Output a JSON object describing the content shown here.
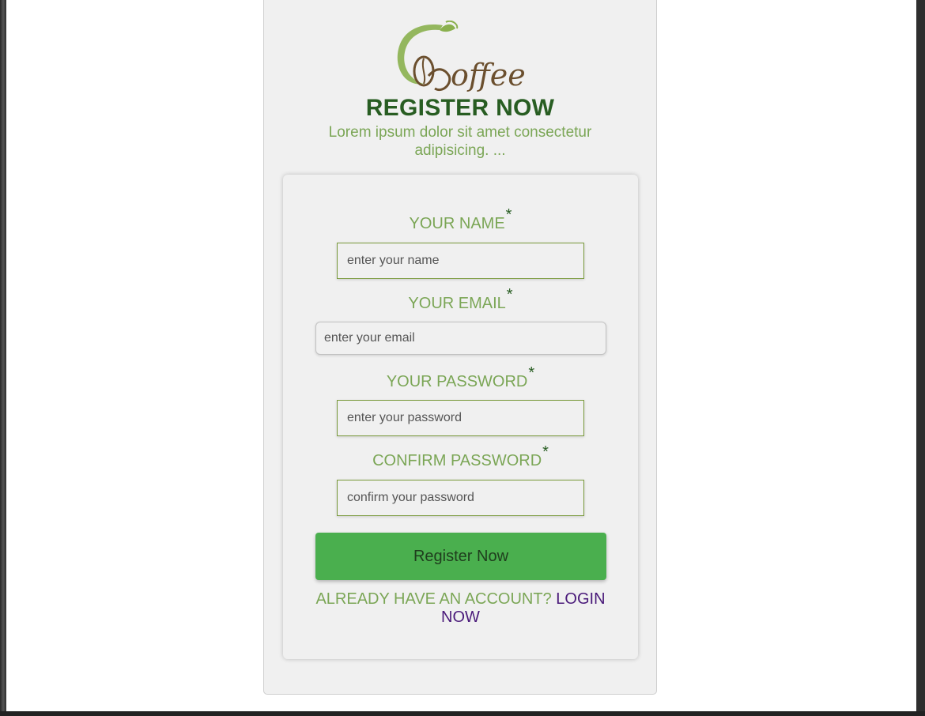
{
  "logo": {
    "text": "Coffee",
    "icon": "coffee-bean-leaf-logo",
    "colors": {
      "leaf": "#8ab04e",
      "bean": "#6b4f2e"
    }
  },
  "header": {
    "title": "REGISTER NOW",
    "subtitle": "Lorem ipsum dolor sit amet consectetur adipisicing. ..."
  },
  "form": {
    "name": {
      "label": "YOUR NAME",
      "required_mark": "*",
      "placeholder": "enter your name"
    },
    "email": {
      "label": "YOUR EMAIL",
      "required_mark": "*",
      "placeholder": "enter your email"
    },
    "password": {
      "label": "YOUR PASSWORD",
      "required_mark": "*",
      "placeholder": "enter your password"
    },
    "confirm": {
      "label": "CONFIRM PASSWORD",
      "required_mark": "*",
      "placeholder": "confirm your password"
    },
    "submit_label": "Register Now"
  },
  "footer": {
    "account_prompt": "ALREADY HAVE AN ACCOUNT?",
    "login_link": "LOGIN NOW"
  },
  "colors": {
    "title": "#285d22",
    "accent_text": "#7ba656",
    "button": "#4aaf4e",
    "link": "#4a1a7a"
  }
}
